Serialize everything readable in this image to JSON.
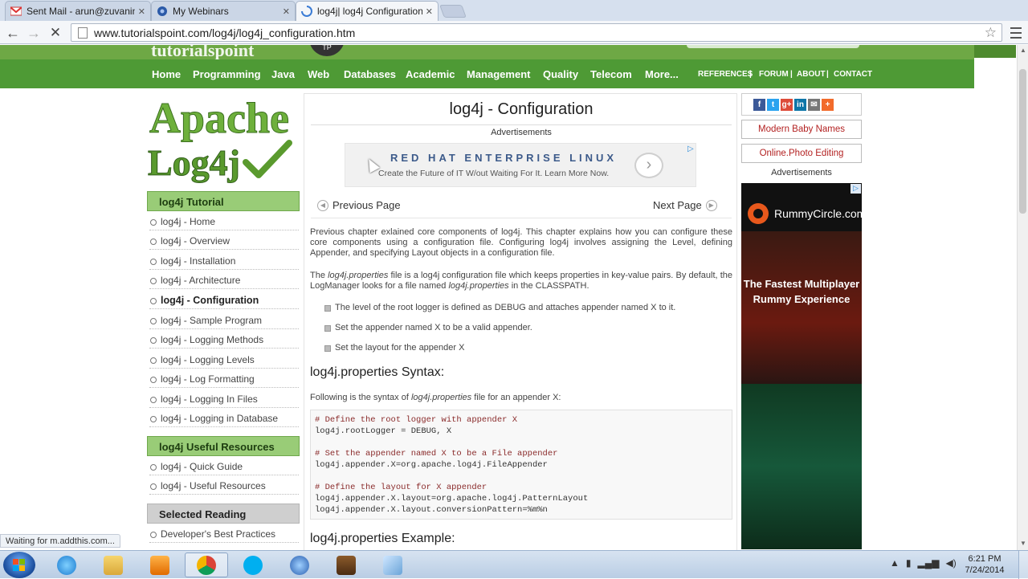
{
  "browser": {
    "tabs": [
      {
        "label": "Sent Mail - arun@zuvanin",
        "icon": "gmail-icon"
      },
      {
        "label": "My Webinars",
        "icon": "webinar-icon"
      },
      {
        "label": "log4j| log4j Configuration|",
        "icon": "loading-spinner-icon"
      }
    ],
    "url": "www.tutorialspoint.com/log4j/log4j_configuration.htm",
    "status": "Waiting for m.addthis.com..."
  },
  "site": {
    "nav": [
      "Home",
      "Programming",
      "Java",
      "Web",
      "Databases",
      "Academic",
      "Management",
      "Quality",
      "Telecom",
      "More..."
    ],
    "small_nav": [
      "REFERENCES",
      "FORUM",
      "ABOUT",
      "CONTACT"
    ],
    "logo_line1": "Apache",
    "logo_line2": "Log4j"
  },
  "sidebar": {
    "tutorial_heading": "log4j Tutorial",
    "items": [
      "log4j - Home",
      "log4j - Overview",
      "log4j - Installation",
      "log4j - Architecture",
      "log4j - Configuration",
      "log4j - Sample Program",
      "log4j - Logging Methods",
      "log4j - Logging Levels",
      "log4j - Log Formatting",
      "log4j - Logging In Files",
      "log4j - Logging in Database"
    ],
    "active_index": 4,
    "resources_heading": "log4j Useful Resources",
    "resources": [
      "log4j - Quick Guide",
      "log4j - Useful Resources"
    ],
    "selected_heading": "Selected Reading",
    "selected_first": "Developer's Best Practices"
  },
  "main": {
    "title": "log4j - Configuration",
    "ads_label": "Advertisements",
    "banner_title": "RED HAT ENTERPRISE LINUX",
    "banner_sub": "Create the Future of IT W/out Waiting For It. Learn More Now.",
    "prev": "Previous Page",
    "next": "Next Page",
    "para1": "Previous chapter exlained core components of log4j. This chapter explains how you can configure these core components using a configuration file. Configuring log4j involves assigning the Level, defining Appender, and specifying Layout objects in a configuration file.",
    "para2_a": "The ",
    "para2_em": "log4j.properties",
    "para2_b": " file is a log4j configuration file which keeps properties in key-value pairs. By default, the LogManager looks for a file named ",
    "para2_em2": "log4j.properties",
    "para2_c": " in the CLASSPATH.",
    "bullets": [
      "The level of the root logger is defined as DEBUG and attaches appender named X to it.",
      "Set the appender named X to be a valid appender.",
      "Set the layout for the appender X"
    ],
    "syntax_heading": "log4j.properties Syntax:",
    "syntax_intro_a": "Following is the syntax of ",
    "syntax_intro_em": "log4j.properties",
    "syntax_intro_b": " file for an appender X:",
    "code": [
      {
        "t": "# Define the root logger with appender X",
        "c": "cm"
      },
      {
        "t": "log4j.rootLogger = DEBUG, X",
        "c": ""
      },
      {
        "t": "",
        "c": ""
      },
      {
        "t": "# Set the appender named X to be a File appender",
        "c": "cm"
      },
      {
        "t": "log4j.appender.X=org.apache.log4j.FileAppender",
        "c": ""
      },
      {
        "t": "",
        "c": ""
      },
      {
        "t": "# Define the layout for X appender",
        "c": "cm"
      },
      {
        "t": "log4j.appender.X.layout=org.apache.log4j.PatternLayout",
        "c": ""
      },
      {
        "t": "log4j.appender.X.layout.conversionPattern=%m%n",
        "c": ""
      }
    ],
    "example_heading": "log4j.properties Example:"
  },
  "right": {
    "buttons": [
      "Modern Baby Names",
      "Online.Photo Editing"
    ],
    "ads_label": "Advertisements",
    "rummy_brand": "RummyCircle.com",
    "rummy_tag": "The Fastest Multiplayer Rummy Experience",
    "share": [
      {
        "icon": "facebook-icon",
        "label": "f",
        "color": "#3b5998"
      },
      {
        "icon": "twitter-icon",
        "label": "t",
        "color": "#2aa3ef"
      },
      {
        "icon": "googleplus-icon",
        "label": "g+",
        "color": "#dd4b39"
      },
      {
        "icon": "linkedin-icon",
        "label": "in",
        "color": "#0e76a8"
      },
      {
        "icon": "email-icon",
        "label": "✉",
        "color": "#777777"
      },
      {
        "icon": "more-share-icon",
        "label": "+",
        "color": "#f26b2b"
      }
    ]
  },
  "taskbar": {
    "time": "6:21 PM",
    "date": "7/24/2014"
  }
}
